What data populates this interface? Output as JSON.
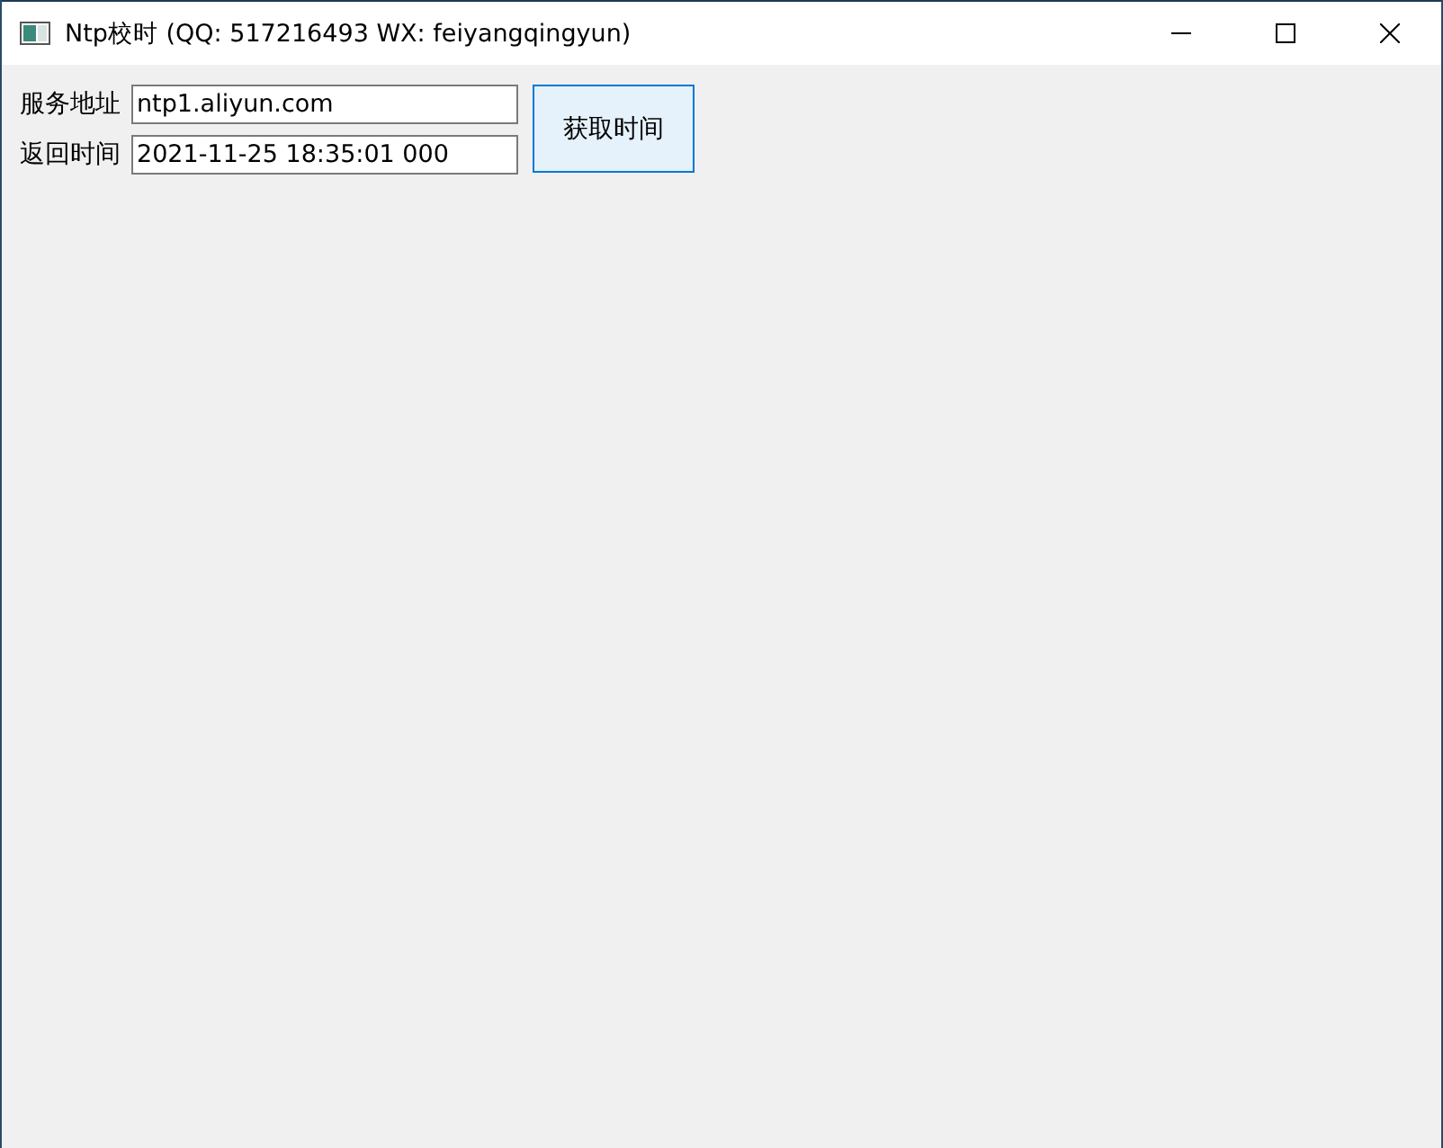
{
  "window": {
    "title": "Ntp校时 (QQ: 517216493 WX: feiyangqingyun)"
  },
  "fields": [
    {
      "label": "服务地址",
      "value": "ntp1.aliyun.com"
    },
    {
      "label": "返回时间",
      "value": "2021-11-25 18:35:01 000"
    }
  ],
  "button": {
    "label": "获取时间"
  }
}
